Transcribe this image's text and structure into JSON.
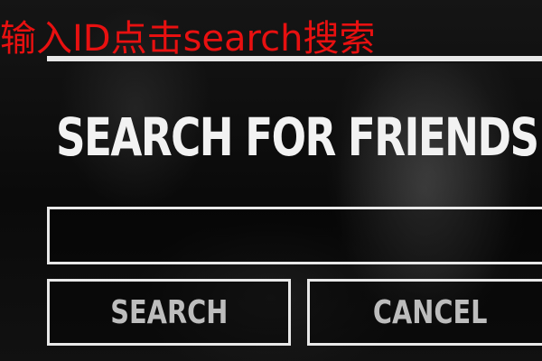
{
  "overlay": {
    "hint_text": "输入ID点击search搜索"
  },
  "dialog": {
    "title": "SEARCH FOR FRIENDS",
    "input_value": "",
    "search_label": "SEARCH",
    "cancel_label": "CANCEL"
  },
  "colors": {
    "hint_red": "#e81010",
    "frame_white": "#e8e8e8",
    "button_text": "#bdbdbd",
    "background": "#0b0b0b"
  }
}
